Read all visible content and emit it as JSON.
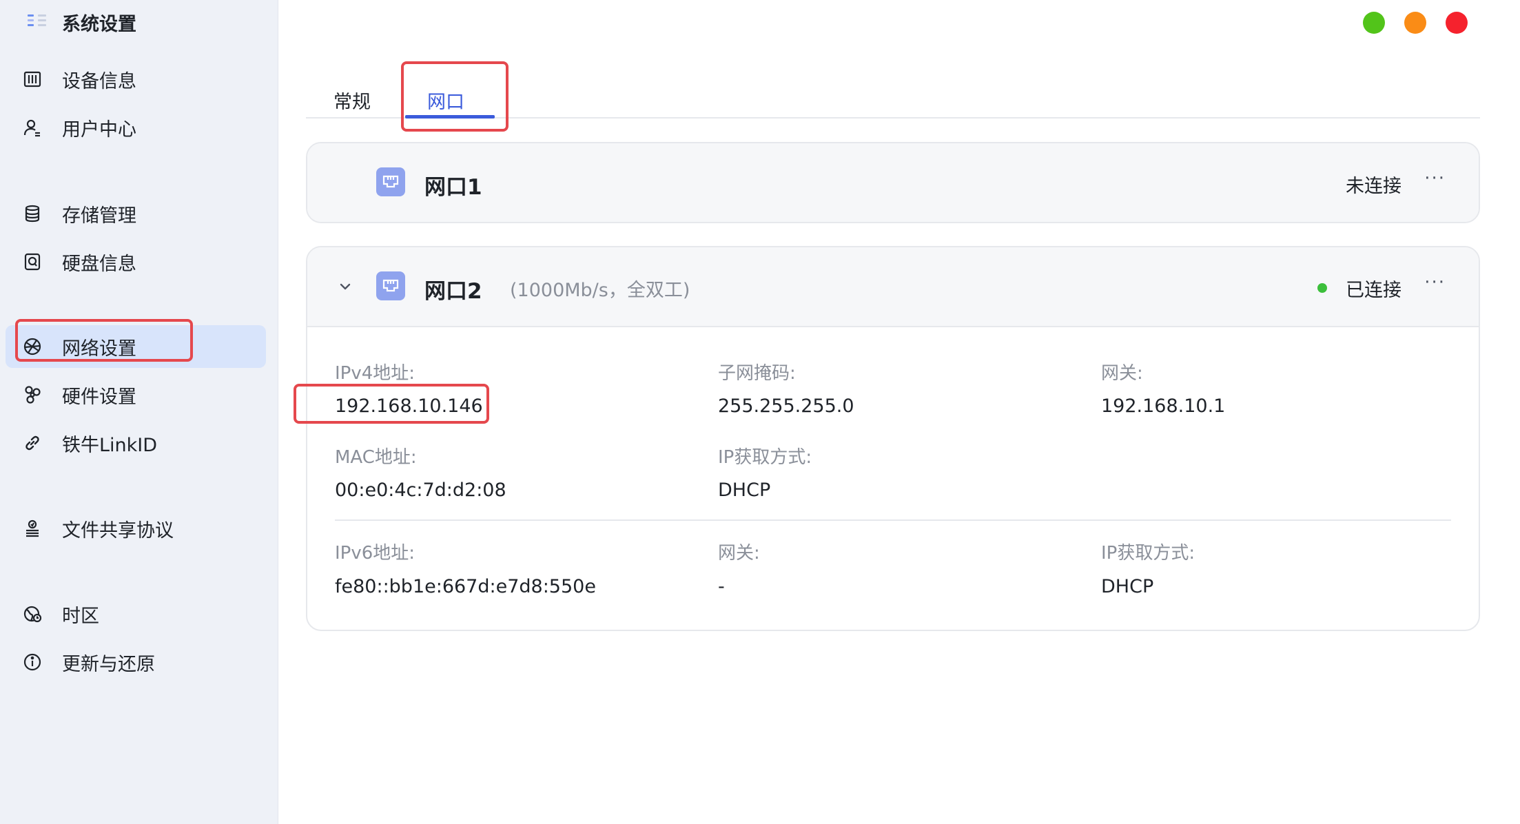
{
  "app": {
    "title": "系统设置"
  },
  "sidebar": {
    "items": [
      {
        "label": "设备信息",
        "icon": "device-info-icon"
      },
      {
        "label": "用户中心",
        "icon": "user-icon"
      },
      {
        "label": "存储管理",
        "icon": "database-icon"
      },
      {
        "label": "硬盘信息",
        "icon": "disk-icon"
      },
      {
        "label": "网络设置",
        "icon": "network-icon",
        "active": true
      },
      {
        "label": "硬件设置",
        "icon": "hardware-icon"
      },
      {
        "label": "铁牛LinkID",
        "icon": "link-icon"
      },
      {
        "label": "文件共享协议",
        "icon": "share-icon"
      },
      {
        "label": "时区",
        "icon": "globe-icon"
      },
      {
        "label": "更新与还原",
        "icon": "info-icon"
      }
    ]
  },
  "window_controls": {
    "colors": [
      "#52c41a",
      "#fa8c16",
      "#f5222d"
    ]
  },
  "tabs": [
    {
      "label": "常规",
      "active": false
    },
    {
      "label": "网口",
      "active": true
    }
  ],
  "ports": [
    {
      "name": "网口1",
      "status": "未连接",
      "more": "···"
    },
    {
      "name": "网口2",
      "speed": "(1000Mb/s，全双工)",
      "status": "已连接",
      "status_color": "#3cbf3c",
      "more": "···",
      "ipv4": {
        "address_label": "IPv4地址:",
        "address": "192.168.10.146",
        "mask_label": "子网掩码:",
        "mask": "255.255.255.0",
        "gateway_label": "网关:",
        "gateway": "192.168.10.1",
        "mac_label": "MAC地址:",
        "mac": "00:e0:4c:7d:d2:08",
        "method_label": "IP获取方式:",
        "method": "DHCP"
      },
      "ipv6": {
        "address_label": "IPv6地址:",
        "address": "fe80::bb1e:667d:e7d8:550e",
        "gateway_label": "网关:",
        "gateway": "-",
        "method_label": "IP获取方式:",
        "method": "DHCP"
      }
    }
  ]
}
